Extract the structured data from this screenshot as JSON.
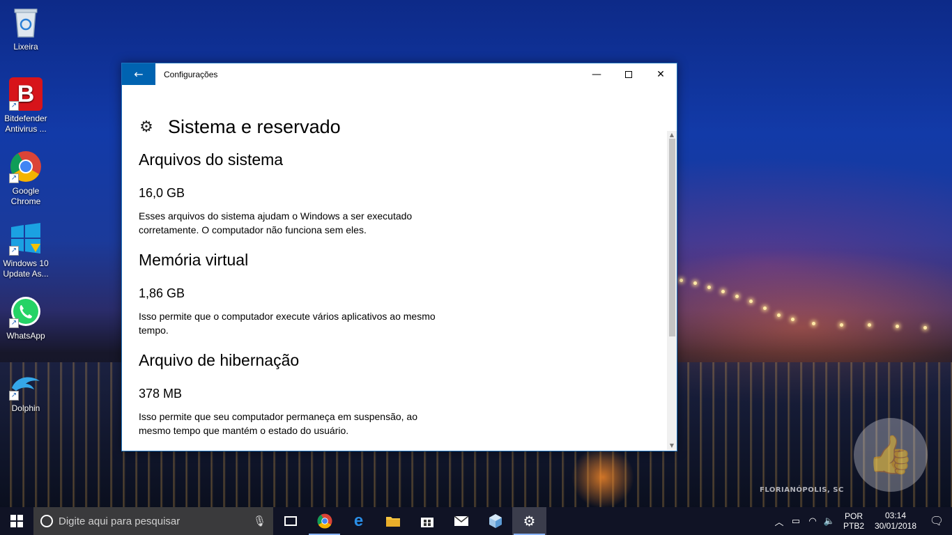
{
  "desktop": {
    "icons": [
      {
        "label": "Lixeira",
        "icon": "recycle-bin-icon"
      },
      {
        "label": "Bitdefender Antivirus ...",
        "icon": "bitdefender-icon"
      },
      {
        "label": "Google Chrome",
        "icon": "chrome-icon"
      },
      {
        "label": "Windows 10 Update As...",
        "icon": "windows-update-icon"
      },
      {
        "label": "WhatsApp",
        "icon": "whatsapp-icon"
      },
      {
        "label": "Dolphin",
        "icon": "dolphin-icon"
      }
    ],
    "watermark": "FLORIANÓPOLIS, SC"
  },
  "window": {
    "app_title": "Configurações",
    "page_title": "Sistema e reservado",
    "sections": [
      {
        "heading": "Arquivos do sistema",
        "size": "16,0 GB",
        "description": "Esses arquivos do sistema ajudam o Windows a ser executado corretamente. O computador não funciona sem eles."
      },
      {
        "heading": "Memória virtual",
        "size": "1,86 GB",
        "description": "Isso permite que o computador execute vários aplicativos ao mesmo tempo."
      },
      {
        "heading": "Arquivo de hibernação",
        "size": "378 MB",
        "description": "Isso permite que seu computador permaneça em suspensão, ao mesmo tempo que mantém o estado do usuário."
      }
    ]
  },
  "taskbar": {
    "search_placeholder": "Digite aqui para pesquisar",
    "apps": [
      {
        "name": "task-view",
        "icon": "task-view-icon"
      },
      {
        "name": "chrome",
        "icon": "chrome-icon"
      },
      {
        "name": "edge",
        "icon": "edge-icon"
      },
      {
        "name": "file-explorer",
        "icon": "folder-icon"
      },
      {
        "name": "store",
        "icon": "store-icon"
      },
      {
        "name": "mail",
        "icon": "mail-icon"
      },
      {
        "name": "app-cube",
        "icon": "cube-icon"
      },
      {
        "name": "settings",
        "icon": "gear-icon"
      }
    ],
    "language_line1": "POR",
    "language_line2": "PTB2",
    "time": "03:14",
    "date": "30/01/2018"
  },
  "colors": {
    "accent": "#0063b1",
    "taskbar": "#10142a"
  }
}
